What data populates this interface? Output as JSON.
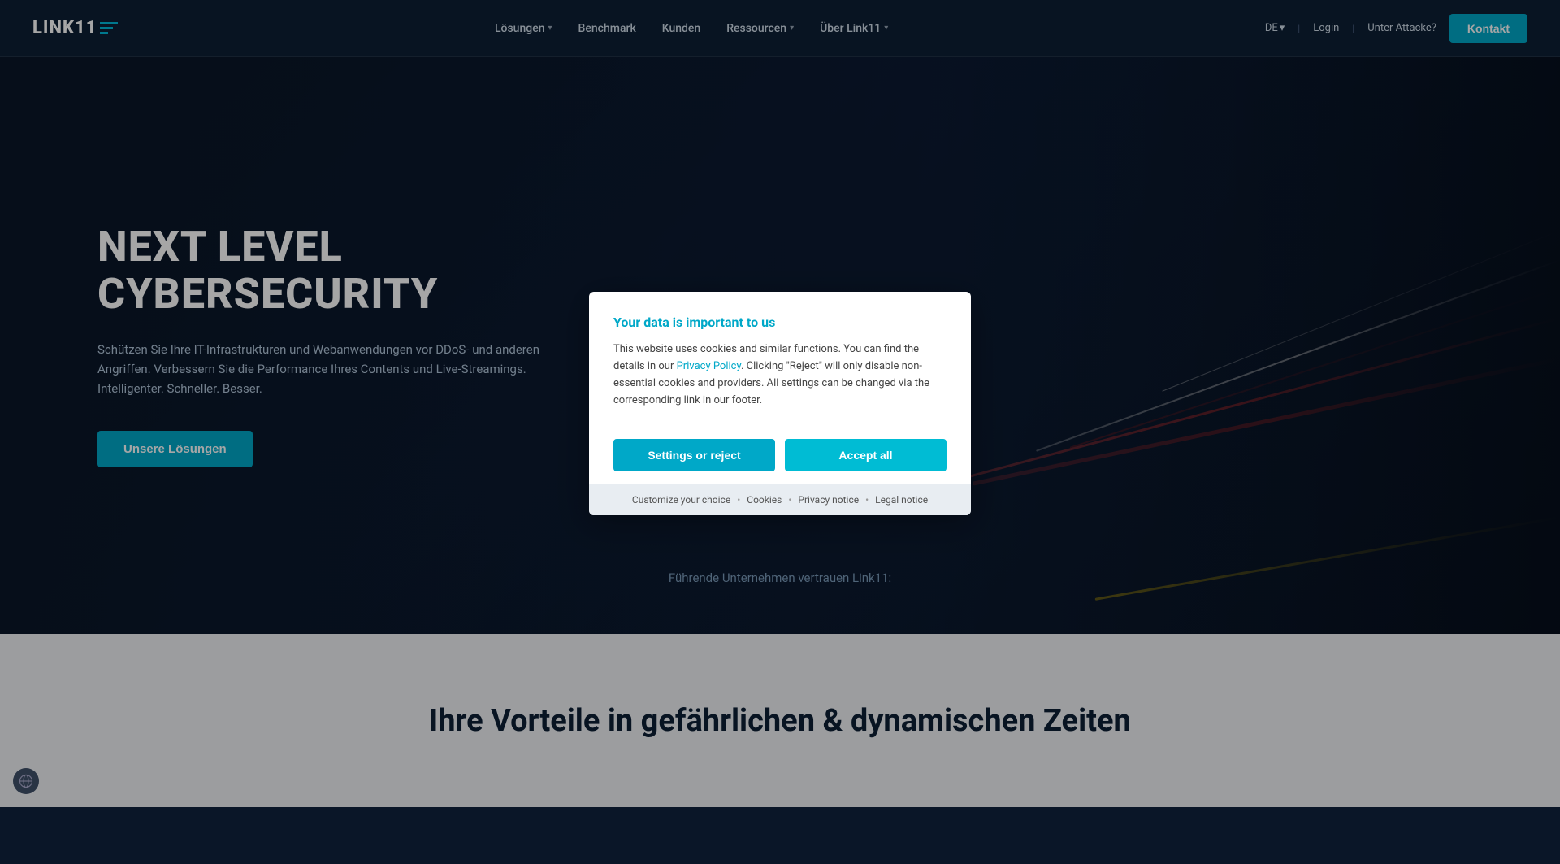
{
  "navbar": {
    "logo_text": "LINK11",
    "nav_items": [
      {
        "label": "Lösungen",
        "has_dropdown": true
      },
      {
        "label": "Benchmark",
        "has_dropdown": false
      },
      {
        "label": "Kunden",
        "has_dropdown": false
      },
      {
        "label": "Ressourcen",
        "has_dropdown": true
      },
      {
        "label": "Über Link11",
        "has_dropdown": true
      }
    ],
    "lang": "DE",
    "login": "Login",
    "separator": "|",
    "under_attack": "Unter Attacke?",
    "contact_button": "Kontakt"
  },
  "hero": {
    "title": "NEXT LEVEL CYBERSECURITY",
    "subtitle": "Schützen Sie Ihre IT-Infrastrukturen und Webanwendungen vor DDoS- und anderen Angriffen. Verbessern Sie die Performance Ihres Contents und Live-Streamings. Intelligenter. Schneller. Besser.",
    "cta_button": "Unsere Lösungen",
    "trust_text": "Führende Unternehmen vertrauen Link11:"
  },
  "below_hero": {
    "title": "Ihre Vorteile in gefährlichen & dynamischen Zeiten"
  },
  "cookie_dialog": {
    "title": "Your data is important to us",
    "body_text": "This website uses cookies and similar functions. You can find the details in our ",
    "policy_link_text": "Privacy Policy",
    "body_text_2": ". Clicking \"Reject\" will only disable non-essential cookies and providers. All settings can be changed via the corresponding link in our footer.",
    "settings_button": "Settings or reject",
    "accept_button": "Accept all",
    "footer_links": [
      {
        "label": "Customize your choice"
      },
      {
        "label": "Cookies"
      },
      {
        "label": "Privacy notice"
      },
      {
        "label": "Legal notice"
      }
    ],
    "footer_separators": "•"
  }
}
